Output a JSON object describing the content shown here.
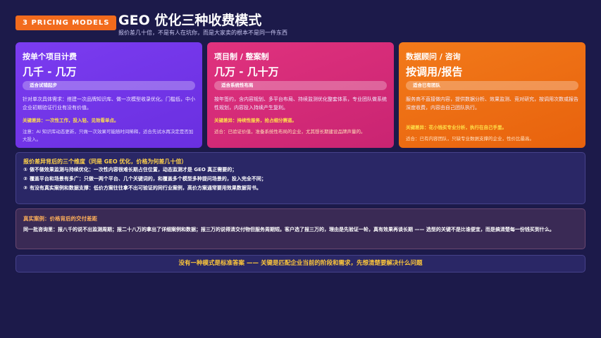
{
  "header": {
    "badge": "3 PRICING MODELS",
    "title": "GEO 优化三种收费模式",
    "subtitle": "报价差几十倍，不是有人在坑你，而是大家卖的根本不是同一件东西"
  },
  "cards": [
    {
      "label": "按单个项目计费",
      "price": "几千 - 几万",
      "tag": "适合试错起步",
      "desc": "针对单次具体需求：搭建一次品牌知识库、做一次模型收录优化。门槛低，中小企业初期验证行业有没有价值。",
      "key": "关键差异：一次性工作，投入轻、见效看单点。",
      "note": "注意：AI 知识库动态更新，只做一次效果可能随时间稀释，适合先试水再决定是否加大投入。"
    },
    {
      "label": "项目制 / 整案制",
      "price": "几万 - 几十万",
      "tag": "适合系统性布局",
      "desc": "按年签约，含内容规划、多平台布局、持续监测优化整套体系，专业团队做系统性规划，内容投入持续产生复利。",
      "key": "关键差异：持续性服务，抢占细分赛道。",
      "note": "适合：已验证价值，准备系统性布局的企业，尤其想长期建设品牌声量的。"
    },
    {
      "label": "数据顾问 / 咨询",
      "price": "按调用/报告",
      "tag": "适合已有团队",
      "desc": "服务商不直接做内容，提供数据分析、效果监测、竞对研究，按调用次数或报告深度收费，内容由自己团队执行。",
      "key": "关键差异：花小钱买专业分析，执行在自己手里。",
      "note": "适合：已有内容团队，只缺专业数据支撑的企业，性价比最高。"
    }
  ],
  "dimensions": {
    "title": "报价差异背后的三个维度（同是 GEO 优化，价格为何差几十倍）",
    "items": [
      {
        "num": "①",
        "text": "做不做效果监测与持续优化：一次性内容很难长期占住位置，动态监测才是 GEO 真正需要的；"
      },
      {
        "num": "②",
        "text": "覆盖平台和场景有多广：只做一两个平台、几个关键词的，和覆盖多个模型多种提问场景的，投入完全不同；"
      },
      {
        "num": "③",
        "text": "有没有真实案例和数据支撑：低价方案往往拿不出可验证的同行业案例，高价方案通常要用效果数据背书。"
      }
    ]
  },
  "case": {
    "title": "真实案例：价格背后的交付差距",
    "text": "同一批咨询里：报八千的说不出监测周期；报二十八万的拿出了详细案例和数据；报三万的说得清交付物但服务周期短。客户选了报三万的，理由是先验证一轮，真有效果再谈长期 —— 选型的关键不是比谁便宜，而是搞清楚每一份钱买到什么。"
  },
  "footer": {
    "text": "没有一种模式是标准答案 —— 关键是匹配企业当前的阶段和需求，先想清楚要解决什么问题"
  },
  "colors": {
    "background": "#1c1a4a",
    "badge": "#f26b1d",
    "card1": "#7b3cf0",
    "card2": "#e0327e",
    "card3": "#f27a1a",
    "highlight": "#ffd24a"
  }
}
